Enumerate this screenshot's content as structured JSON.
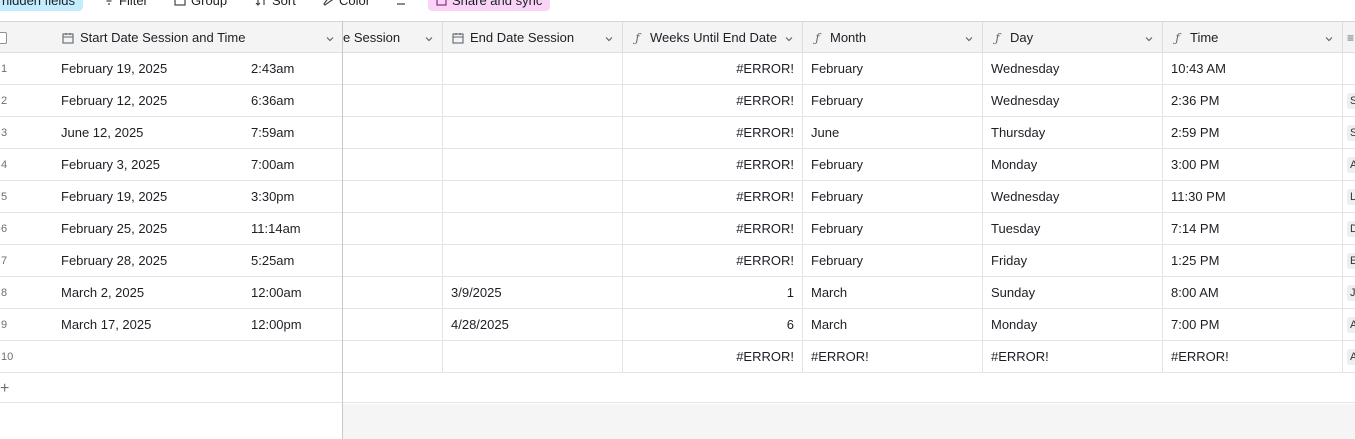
{
  "toolbar": {
    "hidden_fields": "hidden fields",
    "filter": "Filter",
    "group": "Group",
    "sort": "Sort",
    "color": "Color",
    "share_sync": "Share and sync"
  },
  "columns": [
    {
      "label": "Start Date Session and Time",
      "icon": "calendar-icon"
    },
    {
      "label": "e Session",
      "icon": ""
    },
    {
      "label": "End Date Session",
      "icon": "calendar-icon"
    },
    {
      "label": "Weeks Until End Date",
      "icon": "formula-icon"
    },
    {
      "label": "Month",
      "icon": "formula-icon"
    },
    {
      "label": "Day",
      "icon": "formula-icon"
    },
    {
      "label": "Time",
      "icon": "formula-icon"
    }
  ],
  "rows": [
    {
      "n": "1",
      "start_date": "February 19, 2025",
      "start_time": "2:43am",
      "session": "",
      "end_date": "",
      "weeks": "#ERROR!",
      "month": "February",
      "day": "Wednesday",
      "time": "10:43 AM",
      "tag": ""
    },
    {
      "n": "2",
      "start_date": "February 12, 2025",
      "start_time": "6:36am",
      "session": "",
      "end_date": "",
      "weeks": "#ERROR!",
      "month": "February",
      "day": "Wednesday",
      "time": "2:36 PM",
      "tag": "S"
    },
    {
      "n": "3",
      "start_date": "June 12, 2025",
      "start_time": "7:59am",
      "session": "",
      "end_date": "",
      "weeks": "#ERROR!",
      "month": "June",
      "day": "Thursday",
      "time": "2:59 PM",
      "tag": "S"
    },
    {
      "n": "4",
      "start_date": "February 3, 2025",
      "start_time": "7:00am",
      "session": "",
      "end_date": "",
      "weeks": "#ERROR!",
      "month": "February",
      "day": "Monday",
      "time": "3:00 PM",
      "tag": "A"
    },
    {
      "n": "5",
      "start_date": "February 19, 2025",
      "start_time": "3:30pm",
      "session": "",
      "end_date": "",
      "weeks": "#ERROR!",
      "month": "February",
      "day": "Wednesday",
      "time": "11:30 PM",
      "tag": "L"
    },
    {
      "n": "6",
      "start_date": "February 25, 2025",
      "start_time": "11:14am",
      "session": "",
      "end_date": "",
      "weeks": "#ERROR!",
      "month": "February",
      "day": "Tuesday",
      "time": "7:14 PM",
      "tag": "D"
    },
    {
      "n": "7",
      "start_date": "February 28, 2025",
      "start_time": "5:25am",
      "session": "",
      "end_date": "",
      "weeks": "#ERROR!",
      "month": "February",
      "day": "Friday",
      "time": "1:25 PM",
      "tag": "E"
    },
    {
      "n": "8",
      "start_date": "March 2, 2025",
      "start_time": "12:00am",
      "session": "",
      "end_date": "3/9/2025",
      "weeks": "1",
      "month": "March",
      "day": "Sunday",
      "time": "8:00 AM",
      "tag": "J"
    },
    {
      "n": "9",
      "start_date": "March 17, 2025",
      "start_time": "12:00pm",
      "session": "",
      "end_date": "4/28/2025",
      "weeks": "6",
      "month": "March",
      "day": "Monday",
      "time": "7:00 PM",
      "tag": "A"
    },
    {
      "n": "10",
      "start_date": "",
      "start_time": "",
      "session": "",
      "end_date": "",
      "weeks": "#ERROR!",
      "month": "#ERROR!",
      "day": "#ERROR!",
      "time": "#ERROR!",
      "tag": "A"
    }
  ],
  "add_row": "+"
}
